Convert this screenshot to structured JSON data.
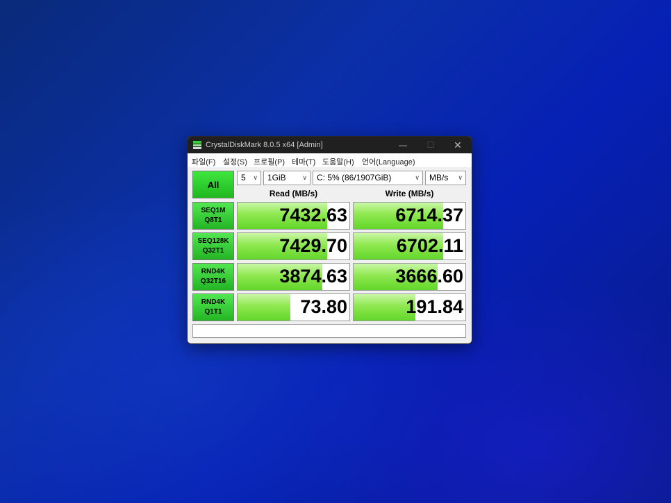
{
  "window": {
    "title": "CrystalDiskMark 8.0.5 x64 [Admin]",
    "controls": {
      "minimize": "—",
      "maximize": "☐",
      "close": "✕"
    }
  },
  "menu": [
    "파일(F)",
    "설정(S)",
    "프로필(P)",
    "테마(T)",
    "도움말(H)",
    "언어(Language)"
  ],
  "toolbar": {
    "all_label": "All",
    "count": "5",
    "size": "1GiB",
    "drive": "C: 5% (86/1907GiB)",
    "unit": "MB/s"
  },
  "headers": {
    "read": "Read (MB/s)",
    "write": "Write (MB/s)"
  },
  "tests": [
    {
      "line1": "SEQ1M",
      "line2": "Q8T1",
      "read": "7432.63",
      "write": "6714.37",
      "read_fill": 0.8,
      "write_fill": 0.8
    },
    {
      "line1": "SEQ128K",
      "line2": "Q32T1",
      "read": "7429.70",
      "write": "6702.11",
      "read_fill": 0.8,
      "write_fill": 0.8
    },
    {
      "line1": "RND4K",
      "line2": "Q32T16",
      "read": "3874.63",
      "write": "3666.60",
      "read_fill": 0.76,
      "write_fill": 0.75
    },
    {
      "line1": "RND4K",
      "line2": "Q1T1",
      "read": "73.80",
      "write": "191.84",
      "read_fill": 0.47,
      "write_fill": 0.55
    }
  ],
  "comment": "",
  "colors": {
    "bar_green": "#62d62a",
    "button_green": "#24b424",
    "titlebar": "#202020"
  },
  "icons": {
    "app": "crystaldiskmark-icon",
    "dropdown": "chevron-down-icon"
  }
}
